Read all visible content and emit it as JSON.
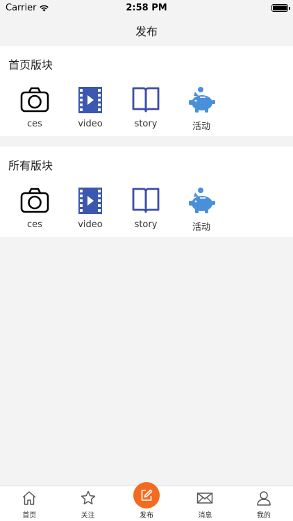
{
  "status": {
    "carrier": "Carrier",
    "time": "2:58 PM"
  },
  "nav": {
    "title": "发布"
  },
  "sections": [
    {
      "title": "首页版块",
      "items": [
        {
          "label": "ces",
          "icon": "camera-icon"
        },
        {
          "label": "video",
          "icon": "film-icon"
        },
        {
          "label": "story",
          "icon": "book-icon"
        },
        {
          "label": "活动",
          "icon": "piggy-bank-icon"
        }
      ]
    },
    {
      "title": "所有版块",
      "items": [
        {
          "label": "ces",
          "icon": "camera-icon"
        },
        {
          "label": "video",
          "icon": "film-icon"
        },
        {
          "label": "story",
          "icon": "book-icon"
        },
        {
          "label": "活动",
          "icon": "piggy-bank-icon"
        }
      ]
    }
  ],
  "tabbar": {
    "items": [
      {
        "label": "首页",
        "icon": "home-icon"
      },
      {
        "label": "关注",
        "icon": "star-icon"
      },
      {
        "label": "发布",
        "icon": "edit-icon"
      },
      {
        "label": "消息",
        "icon": "mail-icon"
      },
      {
        "label": "我的",
        "icon": "user-icon"
      }
    ]
  },
  "colors": {
    "accent": "#f36b21",
    "film": "#3b57b0",
    "book": "#3b4ea8",
    "piggy": "#4a90d9"
  }
}
